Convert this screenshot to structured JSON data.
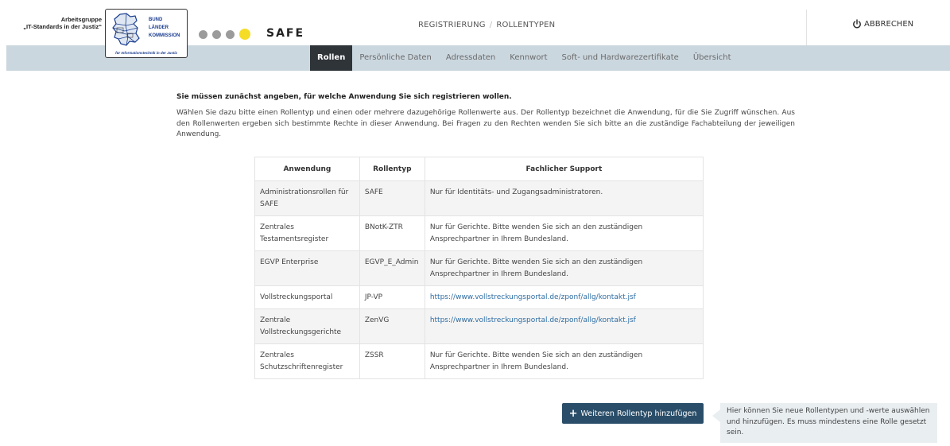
{
  "header": {
    "ag_line1": "Arbeitsgruppe",
    "ag_line2": "„IT-Standards in der Justiz“",
    "blk_line1": "BUND",
    "blk_line2": "LÄNDER",
    "blk_line3": "KOMMISSION",
    "blk_caption": "für Informationstechnik in der Justiz",
    "brand": "SAFE",
    "breadcrumb": [
      "REGISTRIERUNG",
      "ROLLENTYPEN"
    ],
    "breadcrumb_separator": "/",
    "cancel_label": "ABBRECHEN"
  },
  "nav": {
    "tabs": [
      {
        "label": "Rollen",
        "active": true
      },
      {
        "label": "Persönliche Daten",
        "active": false
      },
      {
        "label": "Adressdaten",
        "active": false
      },
      {
        "label": "Kennwort",
        "active": false
      },
      {
        "label": "Soft- und Hardwarezertifikate",
        "active": false
      },
      {
        "label": "Übersicht",
        "active": false
      }
    ]
  },
  "intro": {
    "heading": "Sie müssen zunächst angeben, für welche Anwendung Sie sich registrieren wollen.",
    "body": "Wählen Sie dazu bitte einen Rollentyp und einen oder mehrere dazugehörige Rollenwerte aus. Der Rollentyp bezeichnet die Anwendung, für die Sie Zugriff wünschen. Aus den Rollenwerten ergeben sich bestimmte Rechte in dieser Anwendung. Bei Fragen zu den Rechten wenden Sie sich bitte an die zuständige Fachabteilung der jeweiligen Anwendung."
  },
  "table": {
    "headers": [
      "Anwendung",
      "Rollentyp",
      "Fachlicher Support"
    ],
    "rows": [
      {
        "anwendung": "Administrationsrollen für SAFE",
        "rollentyp": "SAFE",
        "support": "Nur für Identitäts- und Zugangsadministratoren.",
        "is_link": false
      },
      {
        "anwendung": "Zentrales Testamentsregister",
        "rollentyp": "BNotK-ZTR",
        "support": "Nur für Gerichte. Bitte wenden Sie sich an den zuständigen Ansprechpartner in Ihrem Bundesland.",
        "is_link": false
      },
      {
        "anwendung": "EGVP Enterprise",
        "rollentyp": "EGVP_E_Admin",
        "support": "Nur für Gerichte. Bitte wenden Sie sich an den zuständigen Ansprechpartner in Ihrem Bundesland.",
        "is_link": false
      },
      {
        "anwendung": "Vollstreckungsportal",
        "rollentyp": "JP-VP",
        "support": "https://www.vollstreckungsportal.de/zponf/allg/kontakt.jsf",
        "is_link": true
      },
      {
        "anwendung": "Zentrale Vollstreckungsgerichte",
        "rollentyp": "ZenVG",
        "support": "https://www.vollstreckungsportal.de/zponf/allg/kontakt.jsf",
        "is_link": true
      },
      {
        "anwendung": "Zentrales Schutzschriftenregister",
        "rollentyp": "ZSSR",
        "support": "Nur für Gerichte. Bitte wenden Sie sich an den zuständigen Ansprechpartner in Ihrem Bundesland.",
        "is_link": false
      }
    ]
  },
  "actions": {
    "add_plus": "+",
    "add_label": "Weiteren Rollentyp hinzufügen",
    "hint": "Hier können Sie neue Rollentypen und -werte auswählen und hinzufügen. Es muss mindestens eine Rolle gesetzt sein."
  },
  "colors": {
    "navbar": "#cbd7df",
    "active_tab": "#2f3439",
    "add_button": "#2a4e69",
    "link": "#2e6da4",
    "brand_dot": "#f5dc27"
  },
  "icons": {
    "cancel": "power-icon",
    "add": "plus-icon",
    "logo": "germany-map-icon"
  }
}
